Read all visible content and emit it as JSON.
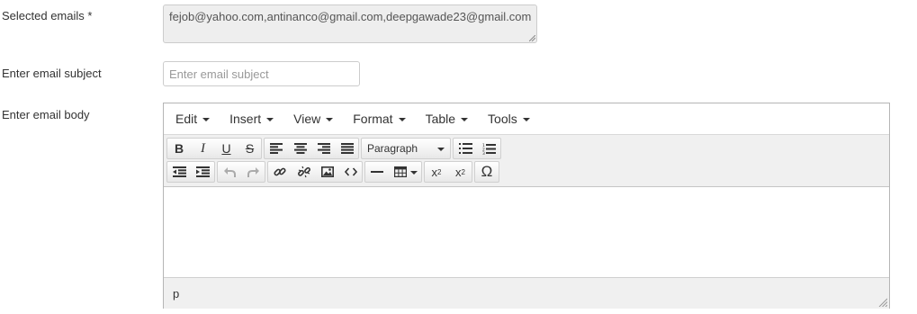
{
  "form": {
    "selected_emails_label": "Selected emails *",
    "selected_emails_value": "fejob@yahoo.com,antinanco@gmail.com,deepgawade23@gmail.com",
    "subject_label": "Enter email subject",
    "subject_placeholder": "Enter email subject",
    "subject_value": "",
    "body_label": "Enter email body"
  },
  "editor": {
    "menu": [
      "Edit",
      "Insert",
      "View",
      "Format",
      "Table",
      "Tools"
    ],
    "toolbar": {
      "bold": "B",
      "italic": "I",
      "underline": "U",
      "strikethrough": "S",
      "format_selected": "Paragraph",
      "subscript": "x",
      "superscript": "x",
      "special_char": "Ω",
      "icons": {
        "align_left": "align-left-icon",
        "align_center": "align-center-icon",
        "align_right": "align-right-icon",
        "justify": "align-justify-icon",
        "bullet_list": "bullet-list-icon",
        "numbered_list": "numbered-list-icon",
        "outdent": "outdent-icon",
        "indent": "indent-icon",
        "undo": "undo-icon",
        "redo": "redo-icon",
        "link": "link-icon",
        "unlink": "unlink-icon",
        "image": "image-icon",
        "code": "code-icon",
        "hr": "horizontal-rule-icon",
        "table": "table-icon"
      }
    },
    "statusbar_path": "p"
  }
}
